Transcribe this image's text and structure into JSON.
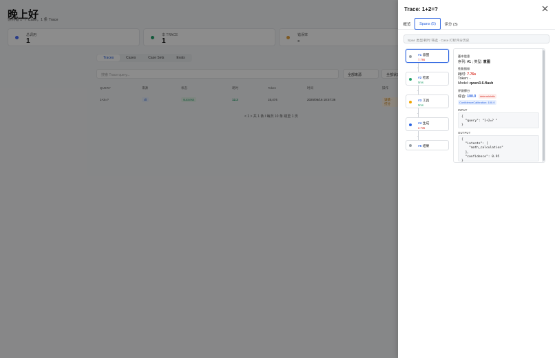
{
  "background": {
    "greeting": "晚上好",
    "subtitle": "你共有 1 个 Case，1 条 Trace",
    "stats": [
      {
        "label": "总调用",
        "value": "1",
        "color": "#4a6cf7"
      },
      {
        "label": "本 TRACE",
        "value": "1",
        "color": "#22a06b"
      },
      {
        "label": "错误率",
        "value": "-",
        "color": "#e6a23c"
      }
    ],
    "tabs": [
      "Traces",
      "Cases",
      "Case Sets",
      "Evals"
    ],
    "search_placeholder": "搜索 Trace query...",
    "filters": [
      "全部来源",
      "全部状态"
    ],
    "table_headers": [
      "QUERY",
      "来源",
      "状态",
      "耗时",
      "Token",
      "时间",
      "操作"
    ],
    "row": {
      "query": "1+2=?",
      "source": "cli",
      "status": "success",
      "duration": "12.2",
      "tokens": "15,474",
      "time": "2025/06/16 18:57:36",
      "action": "详情 · 打分"
    },
    "pager": "< 1 >   共 1 条 / 每页 10 条   跳至 1 页"
  },
  "drawer": {
    "title": "Trace: 1+2=?",
    "close_icon": "close-icon",
    "tabs": [
      {
        "label": "概览",
        "active": false
      },
      {
        "label": "Spans (5)",
        "active": true
      },
      {
        "label": "评分 (3)",
        "active": false
      }
    ],
    "filter_placeholder": "Span 类型/耗时 筛选 · Case 打标评分历史",
    "spans": [
      {
        "index": "#1",
        "name": "意图",
        "time": "7.76s",
        "color": "#9aa0a6",
        "time_color": "#d93025",
        "active": true
      },
      {
        "index": "#2",
        "name": "检索",
        "time": "0ms",
        "color": "#22a06b",
        "time_color": "#22a06b",
        "active": false
      },
      {
        "index": "#3",
        "name": "工具",
        "time": "0ms",
        "color": "#f0a400",
        "time_color": "#22a06b",
        "active": false
      },
      {
        "index": "#4",
        "name": "生成",
        "time": "2.73s",
        "color": "#2b63e0",
        "time_color": "#d93025",
        "active": false
      },
      {
        "index": "#5",
        "name": "结果",
        "time": "",
        "color": "#9aa0a6",
        "time_color": "#22a06b",
        "active": false
      }
    ],
    "detail": {
      "basic_header": "基本信息",
      "seq_label": "序列:",
      "seq_value": "#1",
      "type_label": "类型:",
      "type_value": "意图",
      "perf_header": "性能指标",
      "duration_label": "耗时:",
      "duration_value": "7.76s",
      "token_label": "Token:",
      "token_value": "-",
      "model_label": "Model:",
      "model_value": "qwen3.6-flash",
      "eval_header": "评测得分",
      "score_label": "综合:",
      "score_value": "100.0",
      "score_tag": "deterministic",
      "confidence_tag": "ConfidenceCalibration: 100.0",
      "input_header": "INPUT",
      "input_code": "{\n  \"query\": \"1+2=? \"\n}",
      "output_header": "OUTPUT",
      "output_code": "{\n  \"intents\": [\n    \"math_calculation\"\n  ],\n  \"confidence\": 0.95\n}"
    }
  }
}
